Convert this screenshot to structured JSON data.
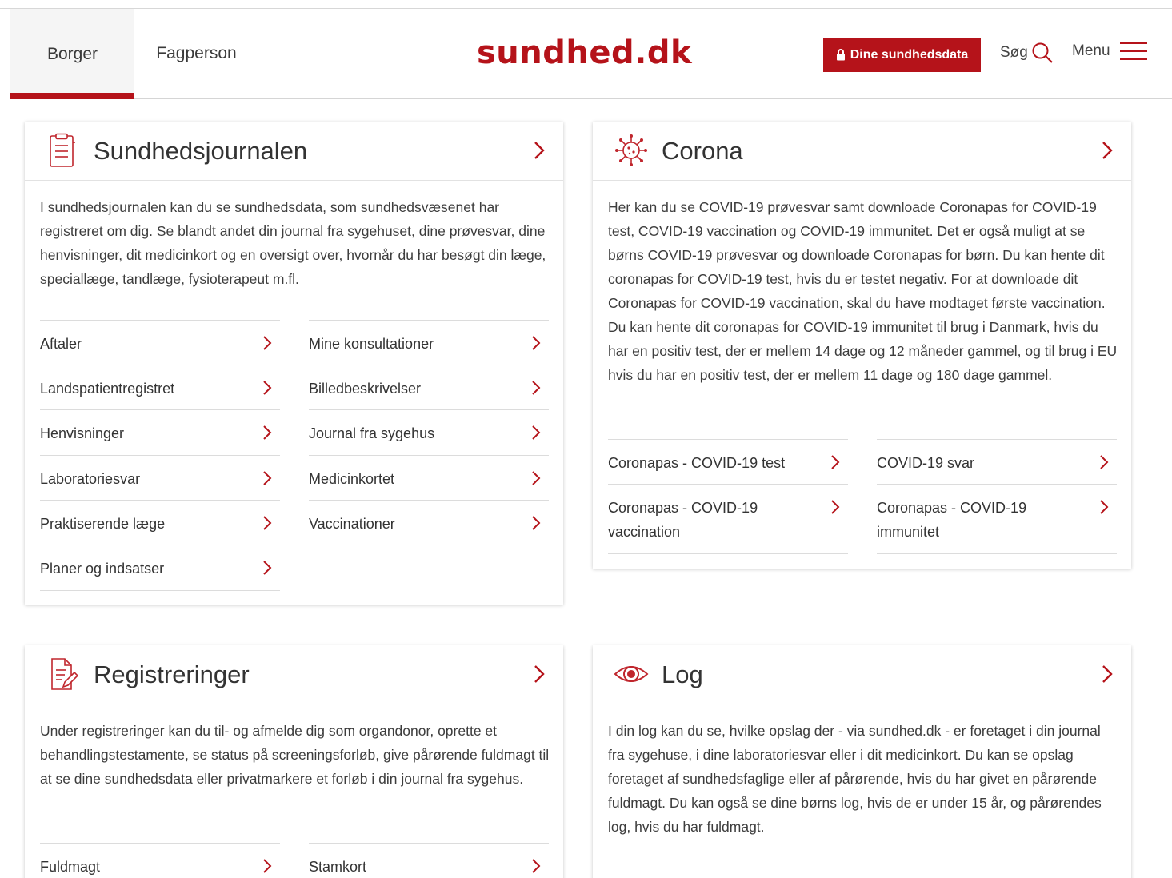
{
  "brand": {
    "logo_text": "sundhed.dk",
    "accent_color": "#b5131a"
  },
  "header": {
    "tabs": [
      {
        "label": "Borger",
        "active": true
      },
      {
        "label": "Fagperson",
        "active": false
      }
    ],
    "data_button_label": "Dine sundhedsdata",
    "search_label": "Søg",
    "menu_label": "Menu"
  },
  "cards": {
    "journal": {
      "title": "Sundhedsjournalen",
      "icon": "clipboard-icon",
      "description": "I sundhedsjournalen kan du se sundhedsdata, som sundhedsvæsenet har registreret om dig. Se blandt andet din journal fra sygehuset, dine prøvesvar, dine henvisninger, dit medicinkort og en oversigt over, hvornår du har besøgt din læge, speciallæge, tandlæge, fysioterapeut m.fl.",
      "links": [
        "Aftaler",
        "Mine konsultationer",
        "Landspatientregistret",
        "Billedbeskrivelser",
        "Henvisninger",
        "Journal fra sygehus",
        "Laboratoriesvar",
        "Medicinkortet",
        "Praktiserende læge",
        "Vaccinationer",
        "Planer og indsatser"
      ]
    },
    "corona": {
      "title": "Corona",
      "icon": "virus-icon",
      "description": "Her kan du se COVID-19 prøvesvar samt downloade Coronapas for COVID-19 test, COVID-19 vaccination og COVID-19 immunitet. Det er også muligt at se børns COVID-19 prøvesvar og downloade Coronapas for børn. Du kan hente dit coronapas for COVID-19 test, hvis du er testet negativ. For at downloade dit Coronapas for COVID-19 vaccination, skal du have modtaget første vaccination. Du kan hente dit coronapas for COVID-19 immunitet til brug i Danmark, hvis du har en positiv test, der er mellem 14 dage og 12 måneder gammel, og til brug i EU hvis du har en positiv test, der er mellem 11 dage og 180 dage gammel.",
      "links": [
        "Coronapas - COVID-19 test",
        "COVID-19 svar",
        "Coronapas - COVID-19 vaccination",
        "Coronapas - COVID-19 immunitet"
      ]
    },
    "registreringer": {
      "title": "Registreringer",
      "icon": "document-edit-icon",
      "description": "Under registreringer kan du til- og afmelde dig som organdonor, oprette et behandlingstestamente, se status på screeningsforløb, give pårørende fuldmagt til at se dine sundhedsdata eller privatmarkere et forløb i din journal fra sygehus.",
      "links": [
        "Fuldmagt",
        "Stamkort"
      ]
    },
    "log": {
      "title": "Log",
      "icon": "eye-icon",
      "description": "I din log kan du se, hvilke opslag der - via sundhed.dk - er foretaget i din journal fra sygehuse, i dine laboratoriesvar eller i dit medicinkort. Du kan se opslag foretaget af sundhedsfaglige eller af pårørende, hvis du har givet en pårørende fuldmagt. Du kan også se dine børns log, hvis de er under 15 år, og pårørendes log, hvis du har fuldmagt."
    }
  }
}
